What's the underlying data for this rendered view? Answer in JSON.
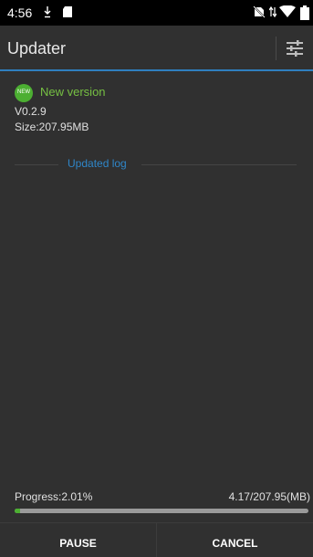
{
  "status_bar": {
    "time": "4:56",
    "left_icons": [
      "download-icon",
      "sd-card-icon"
    ],
    "right_icons": [
      "no-sim-icon",
      "data-arrows-icon",
      "wifi-icon",
      "battery-icon"
    ]
  },
  "app_bar": {
    "title": "Updater",
    "settings_icon": "tune-sliders-icon"
  },
  "update": {
    "badge_text": "NEW",
    "new_version_label": "New version",
    "version": "V0.2.9",
    "size": "Size:207.95MB",
    "log_heading": "Updated log"
  },
  "progress": {
    "label": "Progress:2.01%",
    "percent": 2.01,
    "amount": "4.17/207.95(MB)"
  },
  "buttons": {
    "pause": "PAUSE",
    "cancel": "CANCEL"
  },
  "colors": {
    "accent_blue": "#2f7fbf",
    "new_green": "#4caf32",
    "background": "#303030"
  }
}
